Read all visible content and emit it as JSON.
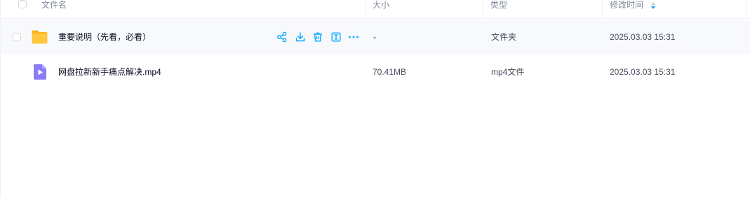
{
  "header": {
    "name_label": "文件名",
    "size_label": "大小",
    "type_label": "类型",
    "modified_label": "修改时间"
  },
  "files": [
    {
      "name": "重要说明（先看，必看）",
      "size": "-",
      "type": "文件夹",
      "modified": "2025.03.03 15:31",
      "icon": "folder-icon",
      "hovered": true
    },
    {
      "name": "网盘拉新新手痛点解决.mp4",
      "size": "70.41MB",
      "type": "mp4文件",
      "modified": "2025.03.03 15:31",
      "icon": "video-file-icon",
      "hovered": false
    }
  ],
  "row_actions": [
    "share-icon",
    "download-icon",
    "delete-icon",
    "rename-icon",
    "more-icon"
  ],
  "colors": {
    "accent": "#06a7ff",
    "folder": "#ffc73e",
    "video": "#8d7cf7",
    "hover_bg": "#f7f9fc",
    "header_text": "#818999"
  }
}
